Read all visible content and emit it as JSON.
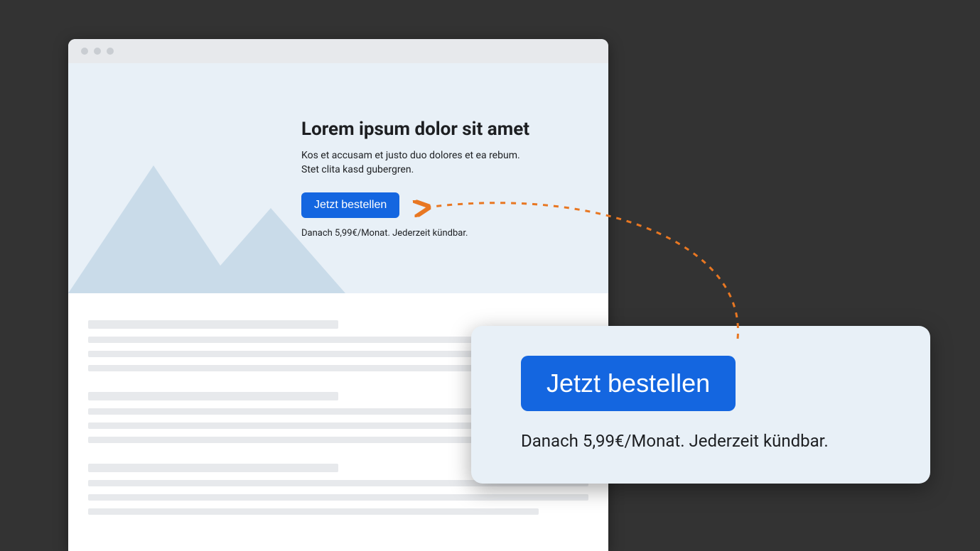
{
  "hero": {
    "title": "Lorem ipsum dolor sit amet",
    "subtitle_line1": "Kos et accusam et justo duo dolores et ea rebum.",
    "subtitle_line2": "Stet clita kasd gubergren.",
    "cta_label": "Jetzt bestellen",
    "price_note": "Danach 5,99€/Monat. Jederzeit kündbar."
  },
  "callout": {
    "cta_label": "Jetzt bestellen",
    "price_note": "Danach 5,99€/Monat. Jederzeit kündbar."
  },
  "colors": {
    "accent": "#1466e0",
    "connector": "#e87722",
    "hero_bg": "#e8f0f7",
    "page_bg": "#333333"
  }
}
